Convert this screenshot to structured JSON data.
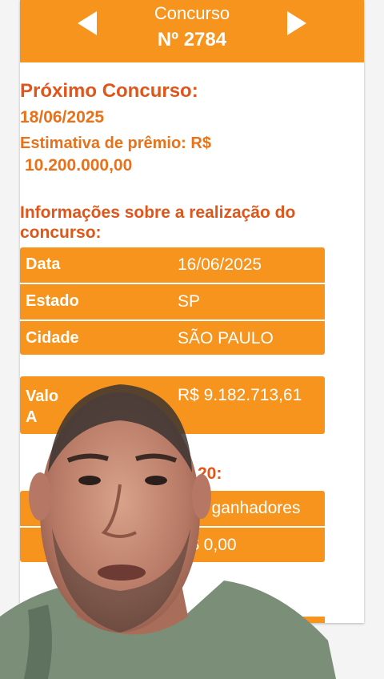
{
  "header": {
    "title": "Concurso",
    "number": "Nº 2784"
  },
  "next": {
    "heading": "Próximo Concurso:",
    "date": "18/06/2025",
    "estimate_label": "Estimativa de prêmio: R$",
    "estimate_value": "10.200.000,00"
  },
  "info": {
    "heading": "Informações sobre a realização do concurso:",
    "rows": [
      {
        "label": "Data",
        "value": "16/06/2025"
      },
      {
        "label": "Estado",
        "value": "SP"
      },
      {
        "label": "Cidade",
        "value": "SÃO PAULO"
      }
    ]
  },
  "prize": {
    "label_line1": "Valo",
    "label_line2": "A",
    "value": "R$  9.182.713,61"
  },
  "winners": {
    "heading_fragment": "20:",
    "rows": [
      {
        "value": "0 ganhadores"
      },
      {
        "value": "R$  0,00"
      }
    ]
  },
  "colors": {
    "accent": "#f7941d",
    "heading": "#e0561a",
    "text_orange": "#e8711a"
  },
  "icons": [
    "chevron-left-icon",
    "chevron-right-icon"
  ]
}
